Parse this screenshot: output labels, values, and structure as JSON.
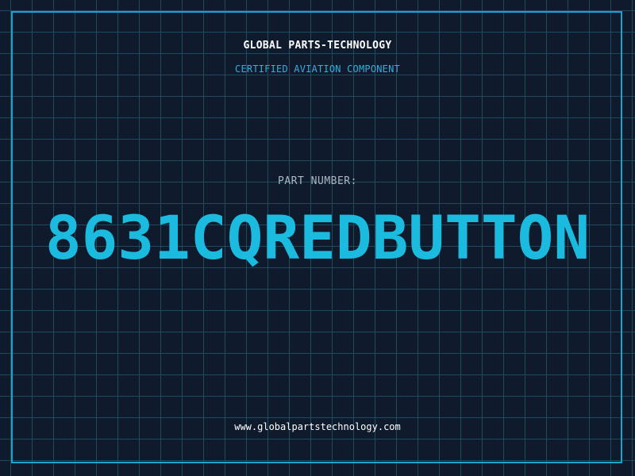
{
  "header": {
    "brand": "GLOBAL PARTS-TECHNOLOGY",
    "subtitle": "CERTIFIED AVIATION COMPONENT"
  },
  "main": {
    "label": "PART NUMBER:",
    "part_number": "8631CQREDBUTTON"
  },
  "footer": {
    "website": "www.globalpartstechnology.com"
  },
  "colors": {
    "background": "#0f1a2c",
    "grid": "#1d4a5c",
    "accent": "#1bbbe0",
    "frame": "#1aa6cc"
  }
}
